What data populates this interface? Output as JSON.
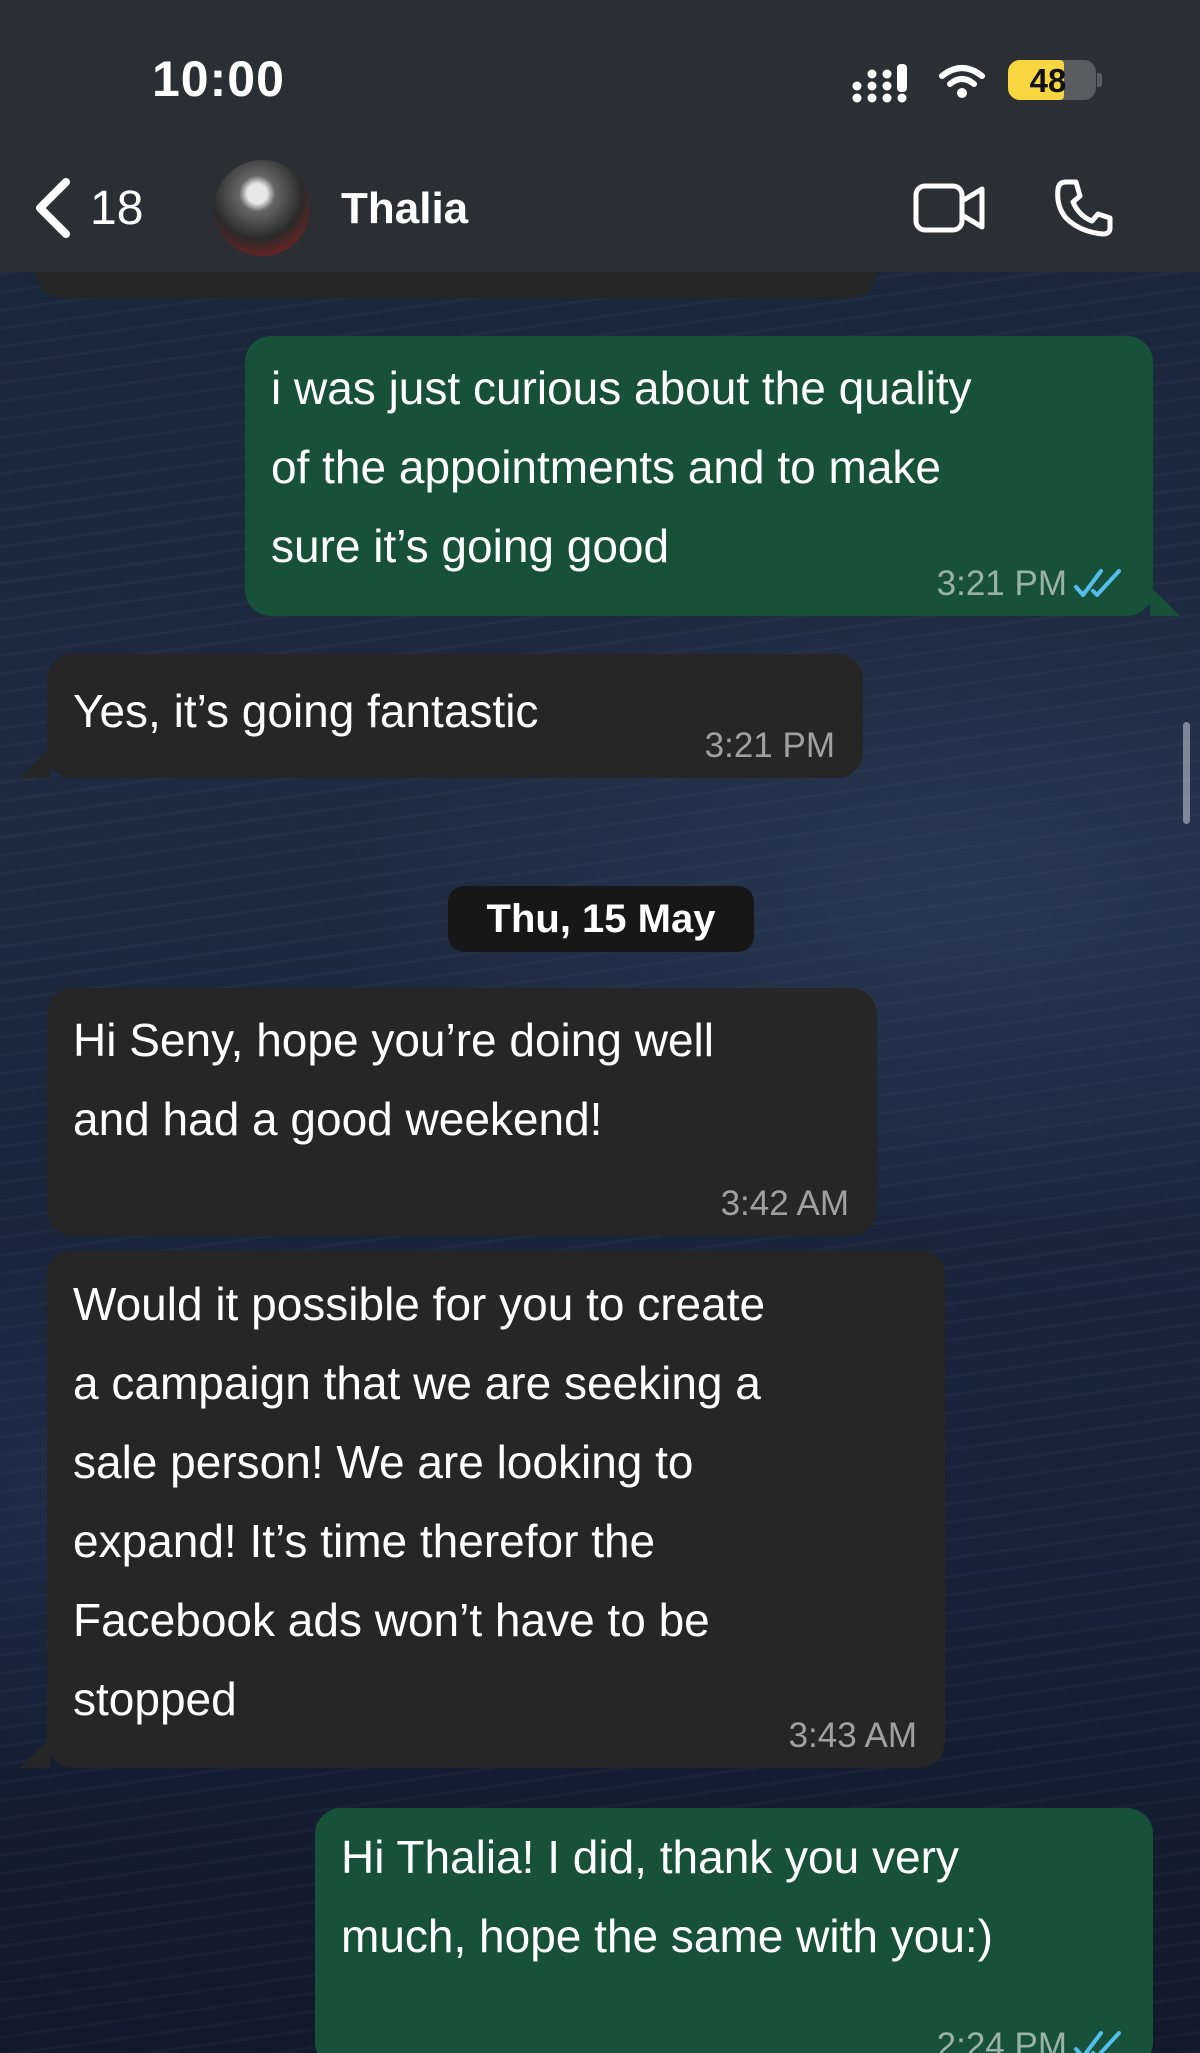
{
  "status_bar": {
    "time": "10:00",
    "battery": "48",
    "icons": [
      "cellular-signal-icon",
      "wifi-icon",
      "battery-icon"
    ]
  },
  "header": {
    "back_count": "18",
    "contact_name": "Thalia",
    "icons": [
      "chevron-left-icon",
      "avatar",
      "video-camera-icon",
      "phone-icon"
    ]
  },
  "date_separator": "Thu, 15 May",
  "messages": [
    {
      "direction": "outgoing",
      "text": "i was just curious about the quality\nof the appointments and to make\nsure it’s going good",
      "time": "3:21 PM",
      "status": "read"
    },
    {
      "direction": "incoming",
      "text": "Yes, it’s going fantastic",
      "time": "3:21 PM"
    },
    {
      "direction": "incoming",
      "text": "Hi Seny, hope you’re doing well\nand had a good weekend!",
      "time": "3:42 AM"
    },
    {
      "direction": "incoming",
      "text": "Would it possible for you to create\na campaign that we are seeking a\nsale person! We are looking to\nexpand! It’s time therefor the\nFacebook ads won’t have to be\nstopped",
      "time": "3:43 AM"
    },
    {
      "direction": "outgoing",
      "text": "Hi Thalia! I did, thank you very\nmuch, hope the same with you:)",
      "time": "2:24 PM",
      "status": "read"
    }
  ],
  "colors": {
    "header_bg": "#2b2e33",
    "incoming_bubble": "#262626",
    "outgoing_bubble": "#17513a",
    "read_ticks": "#53bdeb",
    "battery_fill": "#f7d640"
  }
}
